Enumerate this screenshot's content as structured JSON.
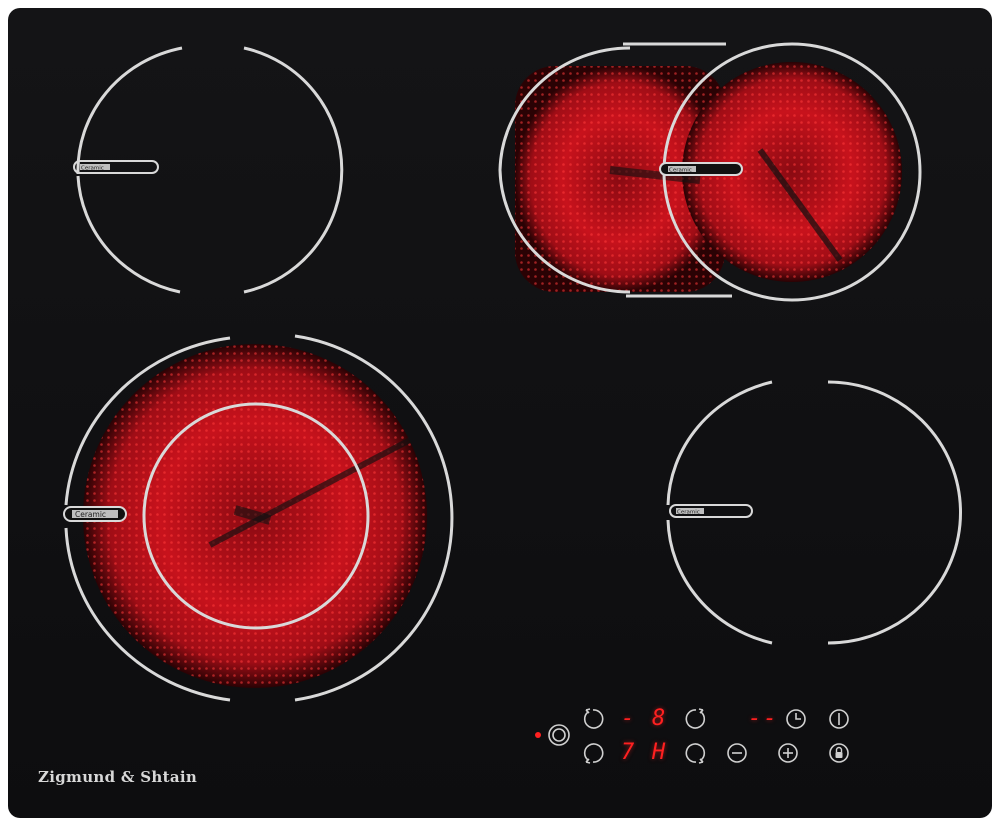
{
  "brand": "Zigmund & Shtain",
  "zones": {
    "top_left": {
      "label": "Ceramic",
      "active": false
    },
    "top_right": {
      "label": "Ceramic",
      "active": true
    },
    "bottom_left": {
      "label": "Ceramic",
      "active": true
    },
    "bottom_right": {
      "label": "Ceramic",
      "active": false
    }
  },
  "display": {
    "row1_left": "-",
    "row1_right": "8",
    "row2_left": "7",
    "row2_right": "H",
    "timer": "--"
  },
  "colors": {
    "glass": "#111113",
    "ring": "#d9d9d9",
    "heat": "#c8101c",
    "indicator": "#ff2020"
  },
  "icons": [
    "extra-zone-icon",
    "zone-top-left-select-icon",
    "zone-top-right-select-icon",
    "zone-bottom-left-select-icon",
    "zone-bottom-right-select-icon",
    "timer-icon",
    "power-icon",
    "minus-icon",
    "plus-icon",
    "lock-icon"
  ]
}
